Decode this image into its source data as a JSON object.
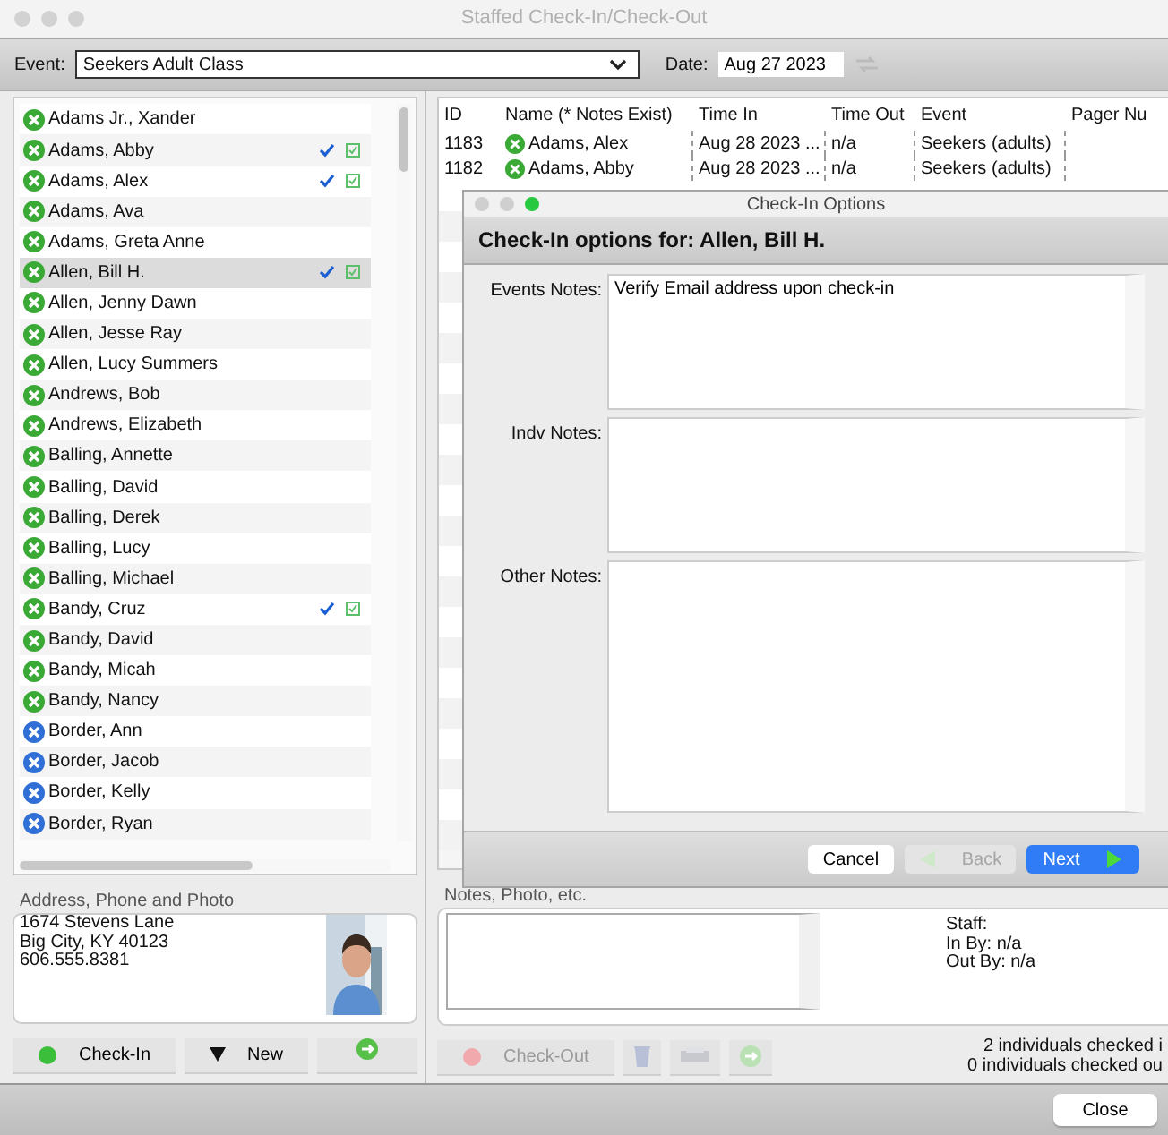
{
  "window": {
    "title": "Staffed Check-In/Check-Out"
  },
  "toolbar": {
    "event_label": "Event:",
    "event_value": "Seekers Adult Class",
    "date_label": "Date:",
    "date_value": "Aug 27 2023"
  },
  "people": [
    {
      "name": "Adams Jr., Xander",
      "color": "#3aa935",
      "checked_in": false,
      "selected": false
    },
    {
      "name": "Adams, Abby",
      "color": "#3aa935",
      "checked_in": true,
      "selected": false
    },
    {
      "name": "Adams, Alex",
      "color": "#3aa935",
      "checked_in": true,
      "selected": false
    },
    {
      "name": "Adams, Ava",
      "color": "#3aa935",
      "checked_in": false,
      "selected": false
    },
    {
      "name": "Adams, Greta Anne",
      "color": "#3aa935",
      "checked_in": false,
      "selected": false
    },
    {
      "name": "Allen, Bill H.",
      "color": "#3aa935",
      "checked_in": true,
      "selected": true
    },
    {
      "name": "Allen, Jenny Dawn",
      "color": "#3aa935",
      "checked_in": false,
      "selected": false
    },
    {
      "name": "Allen, Jesse Ray",
      "color": "#3aa935",
      "checked_in": false,
      "selected": false
    },
    {
      "name": "Allen, Lucy Summers",
      "color": "#3aa935",
      "checked_in": false,
      "selected": false
    },
    {
      "name": "Andrews, Bob",
      "color": "#3aa935",
      "checked_in": false,
      "selected": false
    },
    {
      "name": "Andrews, Elizabeth",
      "color": "#3aa935",
      "checked_in": false,
      "selected": false
    },
    {
      "name": "Balling, Annette",
      "color": "#3aa935",
      "checked_in": false,
      "selected": false
    },
    {
      "name": "Balling, David",
      "color": "#3aa935",
      "checked_in": false,
      "selected": false
    },
    {
      "name": "Balling, Derek",
      "color": "#3aa935",
      "checked_in": false,
      "selected": false
    },
    {
      "name": "Balling, Lucy",
      "color": "#3aa935",
      "checked_in": false,
      "selected": false
    },
    {
      "name": "Balling, Michael",
      "color": "#3aa935",
      "checked_in": false,
      "selected": false
    },
    {
      "name": "Bandy, Cruz",
      "color": "#3aa935",
      "checked_in": true,
      "selected": false
    },
    {
      "name": "Bandy, David",
      "color": "#3aa935",
      "checked_in": false,
      "selected": false
    },
    {
      "name": "Bandy, Micah",
      "color": "#3aa935",
      "checked_in": false,
      "selected": false
    },
    {
      "name": "Bandy, Nancy",
      "color": "#3aa935",
      "checked_in": false,
      "selected": false
    },
    {
      "name": "Border, Ann",
      "color": "#2f6fd6",
      "checked_in": false,
      "selected": false
    },
    {
      "name": "Border, Jacob",
      "color": "#2f6fd6",
      "checked_in": false,
      "selected": false
    },
    {
      "name": "Border, Kelly",
      "color": "#2f6fd6",
      "checked_in": false,
      "selected": false
    },
    {
      "name": "Border, Ryan",
      "color": "#2f6fd6",
      "checked_in": false,
      "selected": false
    }
  ],
  "address": {
    "label": "Address, Phone and Photo",
    "lines": [
      "1674 Stevens Lane",
      "Big City, KY  40123",
      "606.555.8381"
    ]
  },
  "left_buttons": [
    {
      "label": "Check-In",
      "kind": "checkin"
    },
    {
      "label": "New",
      "kind": "new"
    }
  ],
  "table": {
    "columns": [
      "ID",
      "Name (* Notes Exist)",
      "Time In",
      "Time Out",
      "Event",
      "Pager Nu"
    ],
    "rows": [
      {
        "id": "1183",
        "name": "Adams, Alex",
        "color": "#3aa935",
        "time_in": "Aug 28 2023 ...",
        "time_out": "n/a",
        "event": "Seekers (adults)"
      },
      {
        "id": "1182",
        "name": "Adams, Abby",
        "color": "#3aa935",
        "time_in": "Aug 28 2023 ...",
        "time_out": "n/a",
        "event": "Seekers (adults)"
      }
    ]
  },
  "notes": {
    "label": "Notes, Photo, etc.",
    "staff": [
      "Staff:",
      "In By: n/a",
      "Out By: n/a"
    ]
  },
  "checkout": {
    "label": "Check-Out",
    "disabled": true
  },
  "status": [
    "2 individuals checked i",
    "0 individuals checked ou"
  ],
  "dialog": {
    "title": "Check-In Options",
    "heading": "Check-In options for: Allen, Bill H.",
    "fields": [
      {
        "label": "Events Notes:",
        "value": "Verify Email address upon check-in"
      },
      {
        "label": "Indv Notes:"
      },
      {
        "label": "Other Notes:"
      }
    ],
    "buttons": [
      {
        "label": "Cancel",
        "kind": "cancel",
        "disabled": false
      },
      {
        "label": "Back",
        "kind": "back",
        "disabled": true
      },
      {
        "label": "Next",
        "kind": "next",
        "disabled": false
      }
    ]
  },
  "footer": {
    "close": "Close"
  }
}
